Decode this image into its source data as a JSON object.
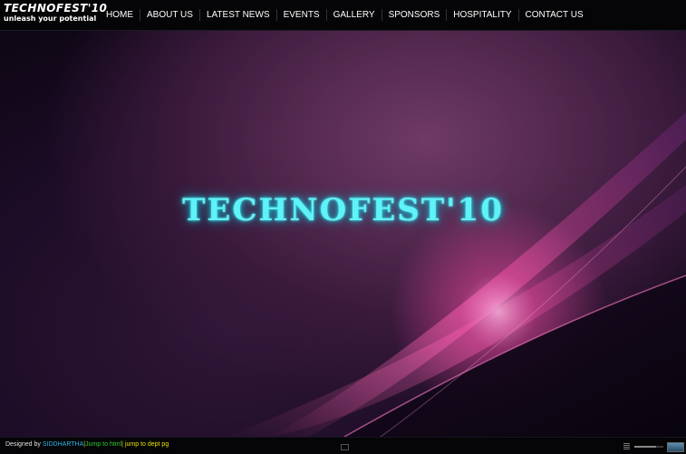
{
  "header": {
    "logo_title": "TECHNOFEST'10",
    "logo_tagline": "unleash your potential",
    "nav": [
      "HOME",
      "ABOUT US",
      "LATEST NEWS",
      "EVENTS",
      "GALLERY",
      "SPONSORS",
      "HOSPITALITY",
      "CONTACT US"
    ]
  },
  "hero": {
    "title": "TECHNOFEST'10"
  },
  "footer": {
    "designed_by": "Designed by",
    "author": "SIDDHARTHA",
    "sep1": "|",
    "jump_html": "Jump to html",
    "sep2": "|",
    "jump_dept": "jump to dept pg",
    "volume_level": 0.75
  },
  "colors": {
    "hero_text": "#5ff2f7",
    "author_link": "#2fb6e6",
    "jump_html": "#2ecc2e",
    "jump_dept": "#e8e000"
  }
}
